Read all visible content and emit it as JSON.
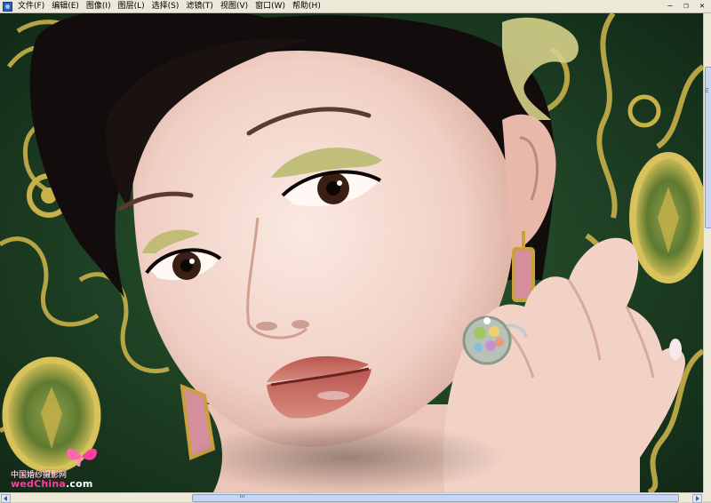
{
  "menubar": {
    "items": [
      {
        "label": "文件(F)"
      },
      {
        "label": "编辑(E)"
      },
      {
        "label": "图像(I)"
      },
      {
        "label": "图层(L)"
      },
      {
        "label": "选择(S)"
      },
      {
        "label": "滤镜(T)"
      },
      {
        "label": "视图(V)"
      },
      {
        "label": "窗口(W)"
      },
      {
        "label": "帮助(H)"
      }
    ],
    "app_icon": "photoshop-app-icon"
  },
  "window_controls": {
    "minimize": "–",
    "restore": "❐",
    "close": "✕"
  },
  "canvas": {
    "image_subject": "portrait-photo",
    "watermark": {
      "cn": "中国婚纱摄影网",
      "en": "wedChina",
      "dotcom": ".com"
    }
  },
  "colors": {
    "background_green": "#1b3a22",
    "ornament_gold": "#c8b04a",
    "chrome": "#ece9d8",
    "scroll_thumb": "#c8d6f0"
  }
}
